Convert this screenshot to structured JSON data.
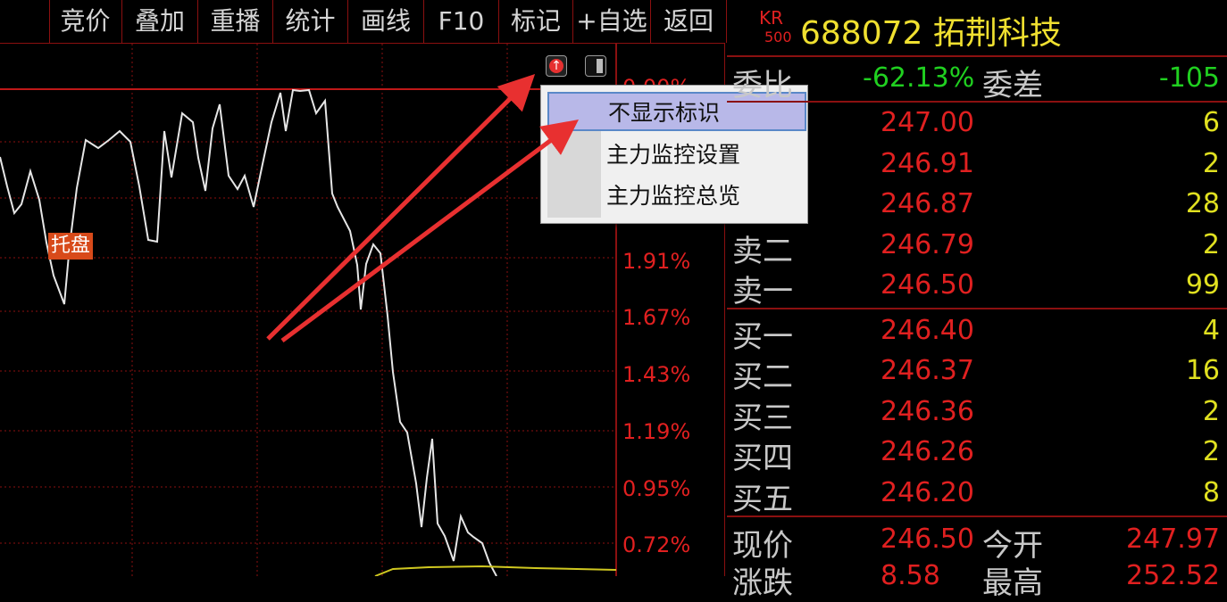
{
  "toolbar": {
    "buttons": [
      "竞价",
      "叠加",
      "重播",
      "统计",
      "画线",
      "F10",
      "标记",
      "+自选",
      "返回"
    ]
  },
  "chart": {
    "pct_labels": [
      "0.00%",
      "1.91%",
      "1.67%",
      "1.43%",
      "1.19%",
      "0.95%",
      "0.72%"
    ],
    "tag_label": "托盘",
    "icons": [
      "up-arrow-icon",
      "panel-toggle-icon"
    ]
  },
  "context_menu": {
    "items": [
      "不显示标识",
      "主力监控设置",
      "主力监控总览"
    ],
    "highlighted_index": 0
  },
  "quote": {
    "badge_top": "KR",
    "badge_bottom": "500",
    "title": "688072 拓荆科技",
    "weibi_label": "委比",
    "weibi_value": "-62.13%",
    "weicha_label": "委差",
    "weicha_value": "-105",
    "sell": [
      {
        "label": "",
        "price": "247.00",
        "vol": "6"
      },
      {
        "label": "",
        "price": "246.91",
        "vol": "2"
      },
      {
        "label": "",
        "price": "246.87",
        "vol": "28"
      },
      {
        "label": "卖二",
        "price": "246.79",
        "vol": "2"
      },
      {
        "label": "卖一",
        "price": "246.50",
        "vol": "99"
      }
    ],
    "buy": [
      {
        "label": "买一",
        "price": "246.40",
        "vol": "4"
      },
      {
        "label": "买二",
        "price": "246.37",
        "vol": "16"
      },
      {
        "label": "买三",
        "price": "246.36",
        "vol": "2"
      },
      {
        "label": "买四",
        "price": "246.26",
        "vol": "2"
      },
      {
        "label": "买五",
        "price": "246.20",
        "vol": "8"
      }
    ],
    "current_label": "现价",
    "current_price": "246.50",
    "open_label": "今开",
    "open_price": "247.97",
    "change_label": "涨跌",
    "change_value": "8.58",
    "high_label": "最高",
    "high_value": "252.52"
  },
  "colors": {
    "background": "#000000",
    "grid_red": "#8b1010",
    "price_red": "#e02020",
    "volume_yellow": "#e0e020",
    "weibi_green": "#20d020",
    "title_yellow": "#f0e030",
    "menu_highlight": "#b8b8e8",
    "arrow_red": "#e83030"
  }
}
